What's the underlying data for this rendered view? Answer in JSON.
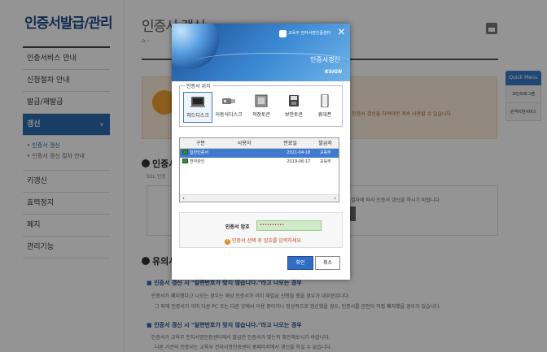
{
  "sidebar": {
    "title": "인증서발급/관리",
    "items": [
      {
        "label": "인증서비스 안내"
      },
      {
        "label": "신청절차 안내"
      },
      {
        "label": "발급/재발급"
      },
      {
        "label": "갱신"
      },
      {
        "label": "키갱신"
      },
      {
        "label": "효력정지"
      },
      {
        "label": "폐지"
      },
      {
        "label": "관리기능"
      }
    ],
    "subitems": [
      {
        "label": "• 인증서 갱신"
      },
      {
        "label": "• 인증서 갱신 절차 안내"
      }
    ]
  },
  "header": {
    "title": "인증서 갱신"
  },
  "main": {
    "warn_text": "인증서 갱신을 하여야만 계속 사용할 수 있습니다.",
    "section1_head": "인증서",
    "section1_sub": "SSL 인증",
    "renew_text": "절차에 따라 인증서 갱신을 하시기 바랍니다.",
    "section2_head": "유의사",
    "notice1_title": "인증서 갱신 시 \"일련번호가 맞지 않습니다.\"라고 나오는 경우",
    "notice1_lines": [
      "인증서가 폐지했다고 나오는 경우는 해당 인증서가 이미 재발급 신청을 했을 경우가 대부분입니다.",
      "그 외에 인증서가 이미 다른 PC 또는 다른 곳에서 이용 중이거나 정상적으로 갱신했을 경우, 인증서를 본인이 직접 폐지했을 경우가 있습니다."
    ],
    "notice2_title": "인증서 갱신 시 \"일련번호가 맞지 않습니다.\"라고 나오는 경우",
    "notice2_lines": [
      "인증서가 교육부 전자서명인증센터에서 발급한 인증서가 맞는지 확인해보시기 바랍니다.",
      "다른 기관의 인증서는 교육부 전자서명인증센터 홈페이지에서 갱신을 하실 수 없습니다."
    ]
  },
  "quick_menu": {
    "title": "Quick Menu",
    "items": [
      {
        "label": "보안프로그램"
      },
      {
        "label": "원격지원서비스"
      }
    ]
  },
  "modal": {
    "org_name": "교육부 전자서명인증센터",
    "title": "인증서갱신",
    "brand": "KSIGN",
    "close_icon": "×",
    "location_legend": "인증서 위치",
    "locations": [
      {
        "label": "하드디스크",
        "icon": "hdd-icon",
        "selected": true
      },
      {
        "label": "이동식디스크",
        "icon": "usb-icon",
        "selected": false
      },
      {
        "label": "저장토큰",
        "icon": "token-icon",
        "selected": false
      },
      {
        "label": "보안토큰",
        "icon": "security-token-icon",
        "selected": false
      },
      {
        "label": "휴대폰",
        "icon": "phone-icon",
        "selected": false
      }
    ],
    "table": {
      "headers": [
        "구분",
        "사용자",
        "만료일",
        "발급자"
      ],
      "rows": [
        {
          "type": "일반인증서",
          "user": "",
          "expiry": "2021-04-18",
          "issuer": "교육부"
        },
        {
          "type": "전자관인",
          "user": "",
          "expiry": "2019-06-17",
          "issuer": "교육부"
        }
      ]
    },
    "password_label": "인증서 암호",
    "password_value": "••••••••••",
    "password_hint": "인증서 선택 후 암호를 입력하세요",
    "ok_label": "확인",
    "cancel_label": "취소"
  }
}
